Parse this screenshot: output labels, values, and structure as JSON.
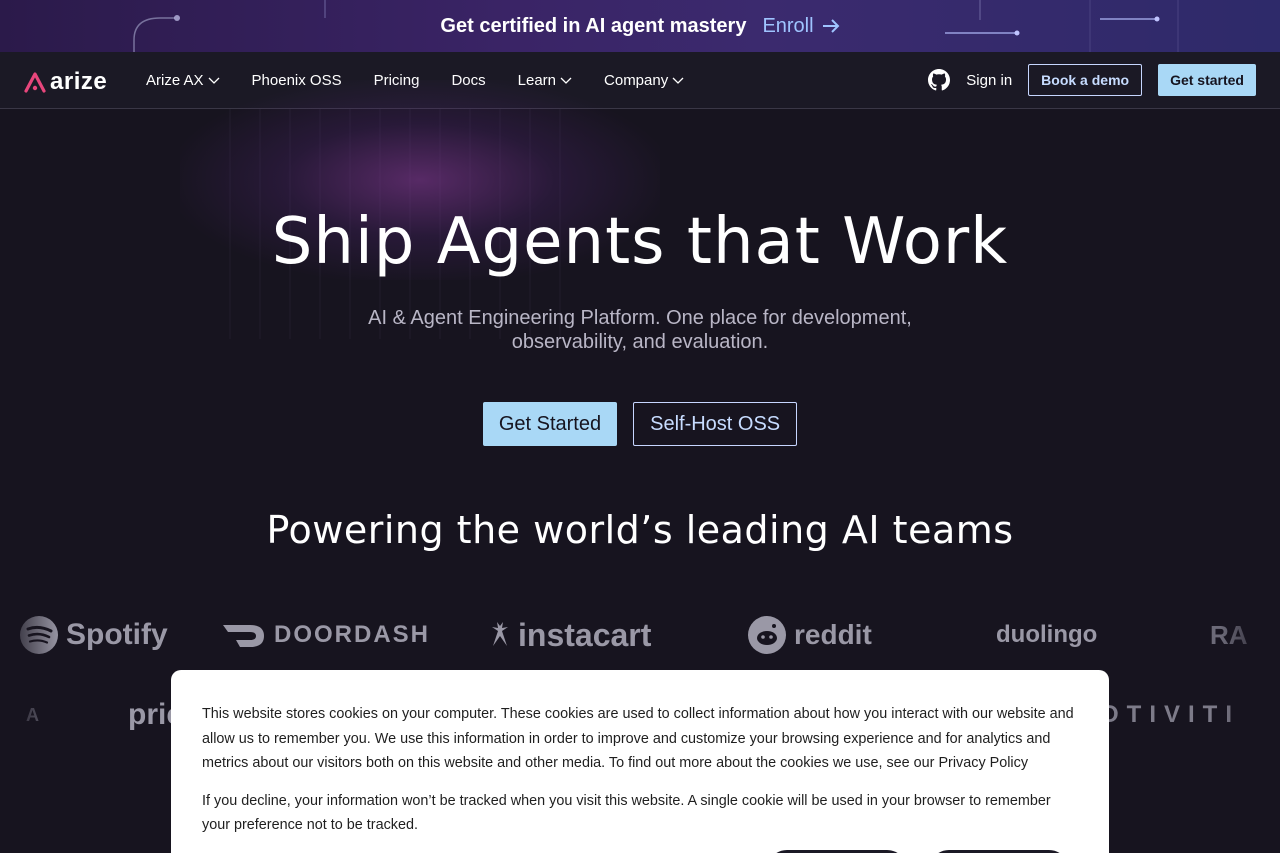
{
  "announcement": {
    "text": "Get certified in AI agent mastery",
    "link_label": "Enroll"
  },
  "nav": {
    "logo_text": "arize",
    "items": [
      {
        "label": "Arize AX",
        "has_dropdown": true
      },
      {
        "label": "Phoenix OSS",
        "has_dropdown": false
      },
      {
        "label": "Pricing",
        "has_dropdown": false
      },
      {
        "label": "Docs",
        "has_dropdown": false
      },
      {
        "label": "Learn",
        "has_dropdown": true
      },
      {
        "label": "Company",
        "has_dropdown": true
      }
    ],
    "signin": "Sign in",
    "book_demo": "Book a demo",
    "get_started": "Get started"
  },
  "hero": {
    "title": "Ship Agents that Work",
    "subtitle": "AI & Agent Engineering Platform. One place for development, observability, and evaluation.",
    "cta_primary": "Get Started",
    "cta_secondary": "Self-Host OSS",
    "powering": "Powering the world’s leading AI teams"
  },
  "logos": {
    "row1": [
      "Spotify",
      "DOORDASH",
      "instacart",
      "reddit",
      "duolingo",
      "RA"
    ],
    "row2": [
      "A",
      "pric",
      "OTIVITI"
    ]
  },
  "cookie": {
    "paragraph1": "This website stores cookies on your computer. These cookies are used to collect information about how you interact with our website and allow us to remember you. We use this information in order to improve and customize your browsing experience and for analytics and metrics about our visitors both on this website and other media. To find out more about the cookies we use, see our Privacy Policy",
    "paragraph2": "If you decline, your information won’t be tracked when you visit this website. A single cookie will be used in your browser to remember your preference not to be tracked."
  },
  "colors": {
    "background": "#17141f",
    "accent_button": "#a9d8f6",
    "link_blue": "#9fc4ff",
    "logo_pink": "#e8467c"
  }
}
